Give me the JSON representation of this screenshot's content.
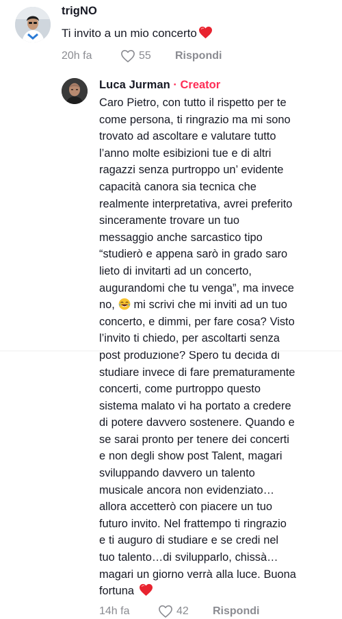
{
  "comments": [
    {
      "username": "trigNO",
      "text": "Ti invito a un mio concerto",
      "emoji": "heart-emoji",
      "time": "20h fa",
      "likes": "55",
      "reply_label": "Rispondi"
    }
  ],
  "reply": {
    "username": "Luca Jurman",
    "separator": " · ",
    "badge": "Creator",
    "lines": [
      "Caro Pietro, con tutto il rispetto per te",
      "come persona, ti ringrazio ma mi sono",
      "trovato ad ascoltare e valutare tutto",
      "l’anno molte esibizioni tue e di altri",
      "ragazzi senza purtroppo un’ evidente",
      "capacità canora sia tecnica che",
      "realmente interpretativa, avrei preferito",
      "sinceramente trovare un tuo",
      "messaggio anche sarcastico tipo",
      "“studierò e appena sarò in grado saro",
      "lieto di invitarti ad un concerto,",
      "augurandomi che tu venga”, ma invece",
      "no,",
      "mi scrivi che mi inviti ad un tuo",
      "concerto, e dimmi, per fare cosa? Visto",
      "l’invito ti chiedo, per ascoltarti senza",
      "post produzione? Spero tu decida di",
      "studiare invece di fare prematuramente",
      "concerti, come purtroppo questo",
      "sistema malato vi ha portato a credere",
      "di potere davvero sostenere. Quando e",
      "se sarai pronto per tenere dei concerti",
      "e non degli show post Talent, magari",
      "sviluppando davvero un talento",
      "musicale ancora non evidenziato…",
      "allora accetterò con piacere un tuo",
      "futuro invito. Nel frattempo ti ringrazio",
      "e ti auguro di studiare e se credi nel",
      "tuo talento…di svilupparlo, chissà…",
      "magari un giorno verrà alla luce. Buona",
      "fortuna"
    ],
    "inline_emoji": "laughing-emoji",
    "end_emoji": "heart-emoji",
    "time": "14h fa",
    "likes": "42",
    "reply_label": "Rispondi"
  },
  "colors": {
    "text": "#161823",
    "muted": "#8a8b91",
    "creator": "#fe2c55",
    "heart": "#e8232f"
  },
  "icons": {
    "like": "heart-outline-icon"
  }
}
